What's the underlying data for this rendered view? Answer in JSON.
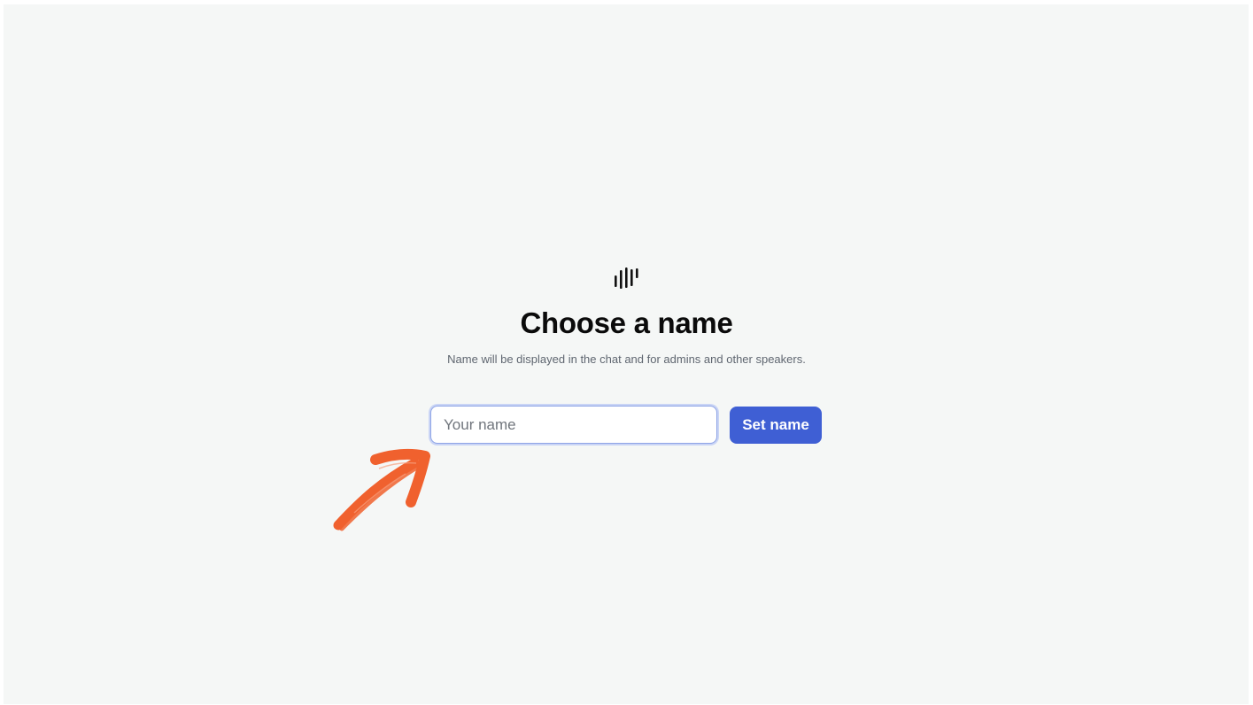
{
  "header": {
    "logo_icon": "soundwave-bars-icon",
    "title": "Choose a name",
    "subtitle": "Name will be displayed in the chat and for admins and other speakers."
  },
  "form": {
    "name_input": {
      "value": "",
      "placeholder": "Your name"
    },
    "submit_label": "Set name"
  },
  "annotation": {
    "icon": "hand-drawn-arrow-icon",
    "color": "#f0612e"
  },
  "colors": {
    "background": "#f5f7f6",
    "accent": "#3f5fd4",
    "title": "#0b0b0b",
    "subtitle": "#5f6670"
  }
}
